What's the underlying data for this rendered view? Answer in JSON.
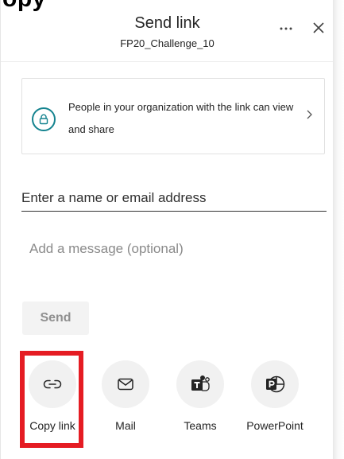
{
  "clipped_heading": "opy",
  "dialog": {
    "title": "Send link",
    "subtitle": "FP20_Challenge_10",
    "more_icon": "ellipsis-icon",
    "close_icon": "close-icon"
  },
  "permission": {
    "icon": "lock-icon",
    "text": "People in your organization with the link can view and share",
    "chevron": "chevron-right-icon"
  },
  "recipient": {
    "placeholder": "Enter a name or email address",
    "value": ""
  },
  "message": {
    "placeholder": "Add a message (optional)",
    "value": ""
  },
  "send_button": {
    "label": "Send",
    "disabled": true
  },
  "share_options": [
    {
      "label": "Copy link",
      "icon": "link-icon",
      "highlighted": true
    },
    {
      "label": "Mail",
      "icon": "mail-icon",
      "highlighted": false
    },
    {
      "label": "Teams",
      "icon": "teams-icon",
      "highlighted": false
    },
    {
      "label": "PowerPoint",
      "icon": "powerpoint-icon",
      "highlighted": false
    }
  ],
  "colors": {
    "accent": "#14838f",
    "highlight": "#e51c23",
    "disabled_text": "#8f8f8f",
    "icon_bg": "#f1f1f1"
  }
}
